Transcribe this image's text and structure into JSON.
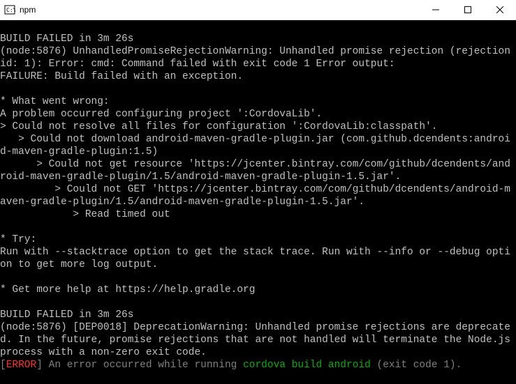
{
  "window": {
    "title": "npm"
  },
  "terminal": {
    "lines": [
      {
        "text": " ",
        "cls": ""
      },
      {
        "text": "BUILD FAILED in 3m 26s",
        "cls": ""
      },
      {
        "text": "(node:5876) UnhandledPromiseRejectionWarning: Unhandled promise rejection (rejection id: 1): Error: cmd: Command failed with exit code 1 Error output:",
        "cls": ""
      },
      {
        "text": "FAILURE: Build failed with an exception.",
        "cls": ""
      },
      {
        "text": " ",
        "cls": ""
      },
      {
        "text": "* What went wrong:",
        "cls": ""
      },
      {
        "text": "A problem occurred configuring project ':CordovaLib'.",
        "cls": ""
      },
      {
        "text": "> Could not resolve all files for configuration ':CordovaLib:classpath'.",
        "cls": ""
      },
      {
        "text": "   > Could not download android-maven-gradle-plugin.jar (com.github.dcendents:android-maven-gradle-plugin:1.5)",
        "cls": ""
      },
      {
        "text": "      > Could not get resource 'https://jcenter.bintray.com/com/github/dcendents/android-maven-gradle-plugin/1.5/android-maven-gradle-plugin-1.5.jar'.",
        "cls": ""
      },
      {
        "text": "         > Could not GET 'https://jcenter.bintray.com/com/github/dcendents/android-maven-gradle-plugin/1.5/android-maven-gradle-plugin-1.5.jar'.",
        "cls": ""
      },
      {
        "text": "            > Read timed out",
        "cls": ""
      },
      {
        "text": " ",
        "cls": ""
      },
      {
        "text": "* Try:",
        "cls": ""
      },
      {
        "text": "Run with --stacktrace option to get the stack trace. Run with --info or --debug option to get more log output.",
        "cls": ""
      },
      {
        "text": " ",
        "cls": ""
      },
      {
        "text": "* Get more help at https://help.gradle.org",
        "cls": ""
      },
      {
        "text": " ",
        "cls": ""
      },
      {
        "text": "BUILD FAILED in 3m 26s",
        "cls": ""
      },
      {
        "text": "(node:5876) [DEP0018] DeprecationWarning: Unhandled promise rejections are deprecated. In the future, promise rejections that are not handled will terminate the Node.js process with a non-zero exit code.",
        "cls": ""
      }
    ],
    "lastLine": {
      "bracketOpen": "[",
      "error": "ERROR",
      "mid": "] An error occurred while running ",
      "cmd": "cordova build android",
      "tail": " (exit code 1)."
    }
  }
}
